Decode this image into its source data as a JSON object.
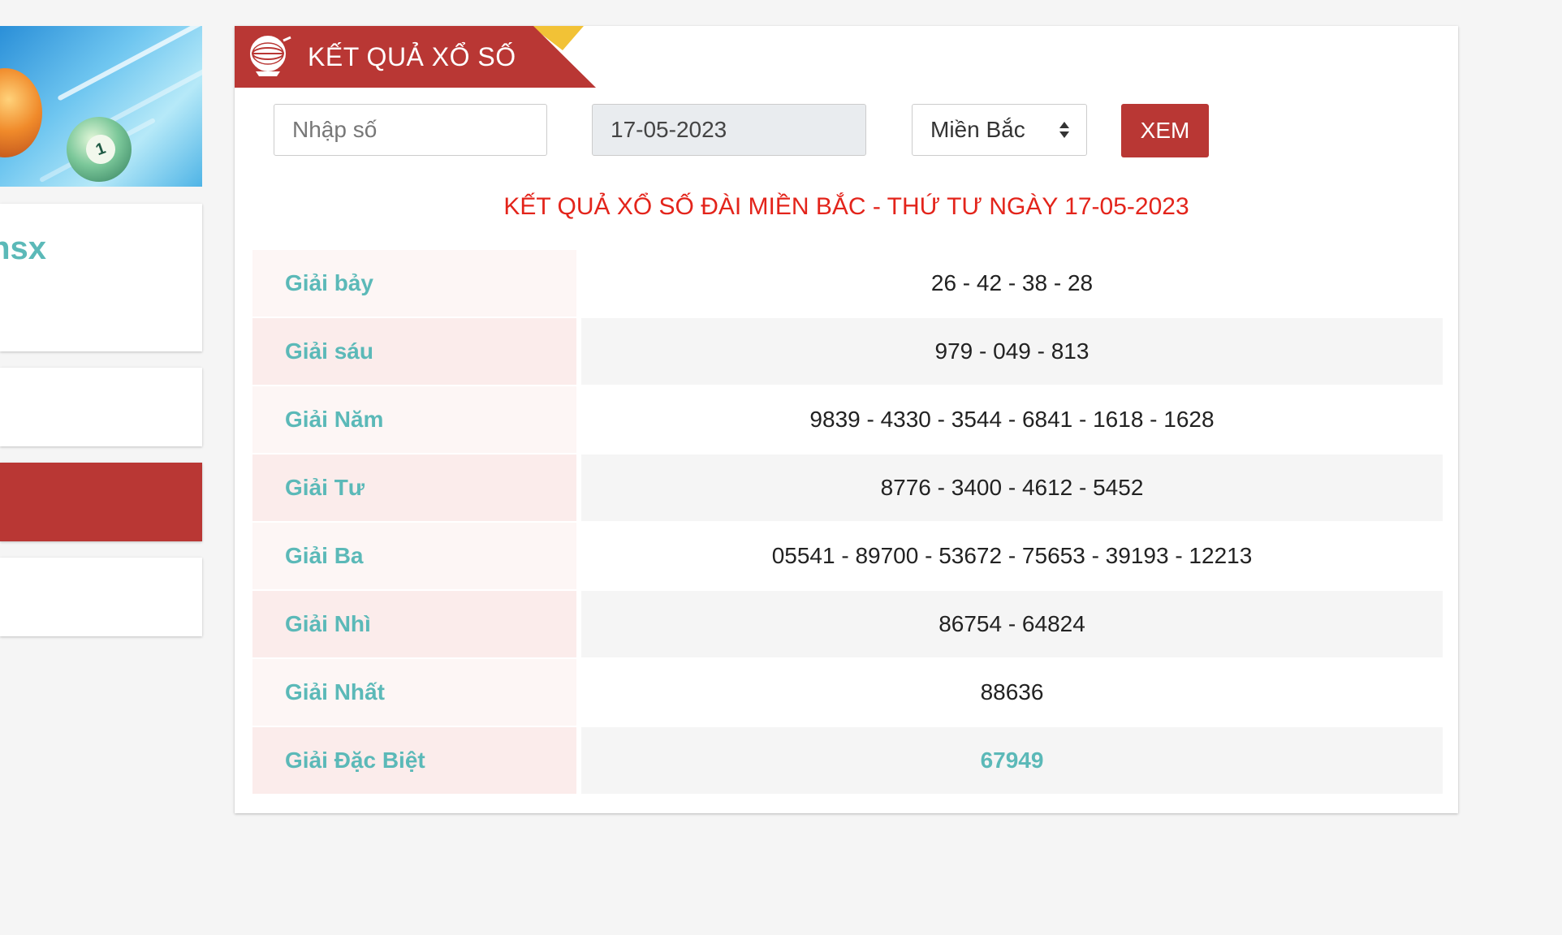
{
  "sidebar": {
    "partial_title": "nsx"
  },
  "header": {
    "title": "KẾT QUẢ XỔ SỐ"
  },
  "form": {
    "number_placeholder": "Nhập số",
    "date_value": "17-05-2023",
    "region_value": "Miền Bắc",
    "submit_label": "XEM"
  },
  "result_heading": "KẾT QUẢ XỔ SỐ ĐÀI MIỀN BẮC - THỨ TƯ NGÀY 17-05-2023",
  "prizes": [
    {
      "label": "Giải bảy",
      "numbers": "26 - 42 - 38 - 28"
    },
    {
      "label": "Giải sáu",
      "numbers": "979 - 049 - 813"
    },
    {
      "label": "Giải Năm",
      "numbers": "9839 - 4330 - 3544 - 6841 - 1618 - 1628"
    },
    {
      "label": "Giải Tư",
      "numbers": "8776 - 3400 - 4612 - 5452"
    },
    {
      "label": "Giải Ba",
      "numbers": "05541 - 89700 - 53672 - 75653 - 39193 - 12213"
    },
    {
      "label": "Giải Nhì",
      "numbers": "86754 - 64824"
    },
    {
      "label": "Giải Nhất",
      "numbers": "88636"
    },
    {
      "label": "Giải Đặc Biệt",
      "numbers": "67949"
    }
  ],
  "colors": {
    "brand_red": "#b93734",
    "heading_red": "#e3241b",
    "teal": "#5bb9b8",
    "ribbon_accent": "#f2c236"
  }
}
